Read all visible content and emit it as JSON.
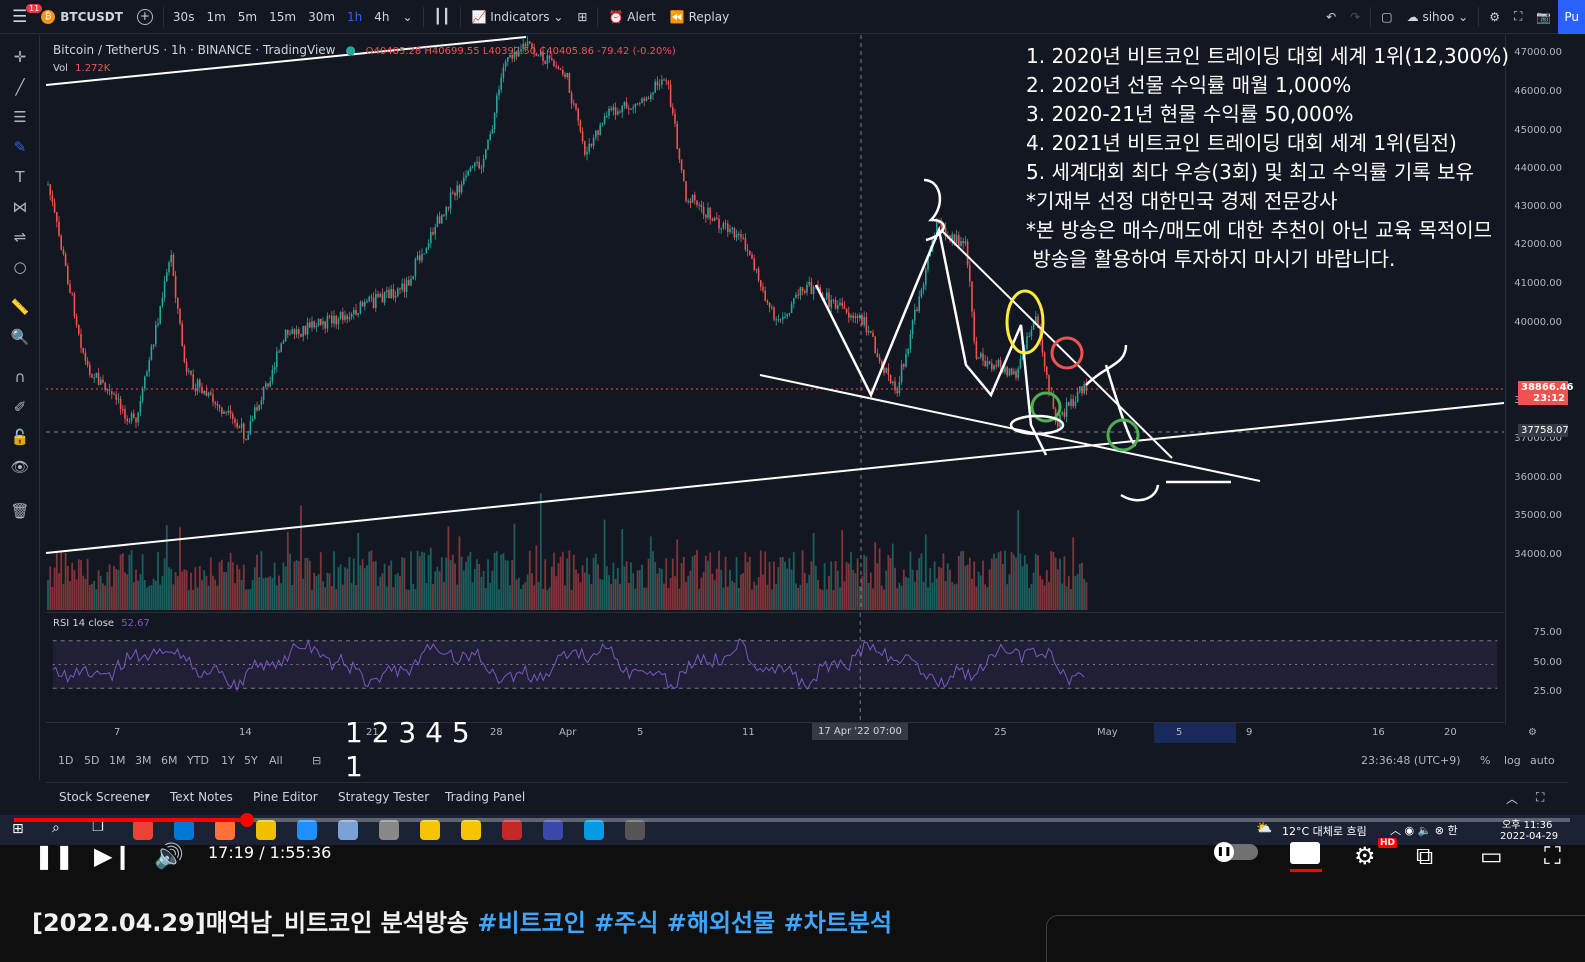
{
  "topbar": {
    "notif_count": "11",
    "symbol": "BTCUSDT",
    "intervals": [
      "30s",
      "1m",
      "5m",
      "15m",
      "30m",
      "1h",
      "4h"
    ],
    "active_interval": "1h",
    "indicators_label": "Indicators",
    "alert_label": "Alert",
    "replay_label": "Replay",
    "user": "sihoo",
    "publish_label": "Pu"
  },
  "legend": {
    "title": "Bitcoin / TetherUS · 1h · BINANCE · TradingView",
    "ohlc": "O40485.28 H40699.55 L40392.50 C40405.86 -79.42 (-0.20%)",
    "vol_label": "Vol",
    "vol_value": "1.272K",
    "rsi_label": "RSI 14 close",
    "rsi_value": "52.67"
  },
  "colors": {
    "up": "#26a69a",
    "down": "#ef5350",
    "rsi": "#7e57c2",
    "background": "#131722",
    "accent": "#2962ff",
    "youtube_red": "#ff0000"
  },
  "price_axis": {
    "ticks": [
      "47000.00",
      "46000.00",
      "45000.00",
      "44000.00",
      "43000.00",
      "42000.00",
      "41000.00",
      "40000.00",
      "38000.00",
      "37000.00",
      "36000.00",
      "35000.00",
      "34000.00"
    ],
    "current_price": "38866.46",
    "countdown": "23:12",
    "crosshair_price": "37758.07",
    "rsi_ticks": [
      "75.00",
      "50.00",
      "25.00"
    ]
  },
  "time_axis": {
    "labels": [
      "7",
      "14",
      "21",
      "28",
      "Apr",
      "5",
      "11",
      "25",
      "May",
      "5",
      "9",
      "16",
      "20"
    ],
    "crosshair_label": "17 Apr '22   07:00"
  },
  "range_bar": {
    "ranges": [
      "1D",
      "5D",
      "1M",
      "3M",
      "6M",
      "YTD",
      "1Y",
      "5Y",
      "All"
    ],
    "clock": "23:36:48 (UTC+9)",
    "options": [
      "%",
      "log",
      "auto"
    ]
  },
  "bottom_tabs": [
    "Stock Screener",
    "Text Notes",
    "Pine Editor",
    "Strategy Tester",
    "Trading Panel"
  ],
  "overlay_lines": [
    "1. 2020년 비트코인 트레이딩 대회 세계 1위(12,300%)",
    "2. 2020년 선물 수익률 매월 1,000%",
    "3. 2020-21년 현물 수익률 50,000%",
    "4. 2021년 비트코인 트레이딩 대회 세계 1위(팀전)",
    "5. 세계대회 최다 우승(3회) 및 최고 수익률 기록 보유",
    "*기재부 선정 대한민국 경제 전문강사",
    "*본 방송은 매수/매도에 대한 추천이 아닌 교육 목적이므",
    " 방송을 활용하여 투자하지 마시기 바랍니다."
  ],
  "number_overlay": {
    "line1": "1 2 3 4 5",
    "line2": "1"
  },
  "taskbar": {
    "weather": "12°C  대체로 흐림",
    "time": "오후 11:36",
    "date": "2022-04-29"
  },
  "player": {
    "timecode": "17:19 / 1:55:36",
    "progress": 0.15,
    "hd_badge": "HD"
  },
  "video": {
    "title_prefix": "[2022.04.29]매억남_비트코인 분석방송",
    "hashtags": [
      "#비트코인",
      "#주식",
      "#해외선물",
      "#차트분석"
    ]
  }
}
